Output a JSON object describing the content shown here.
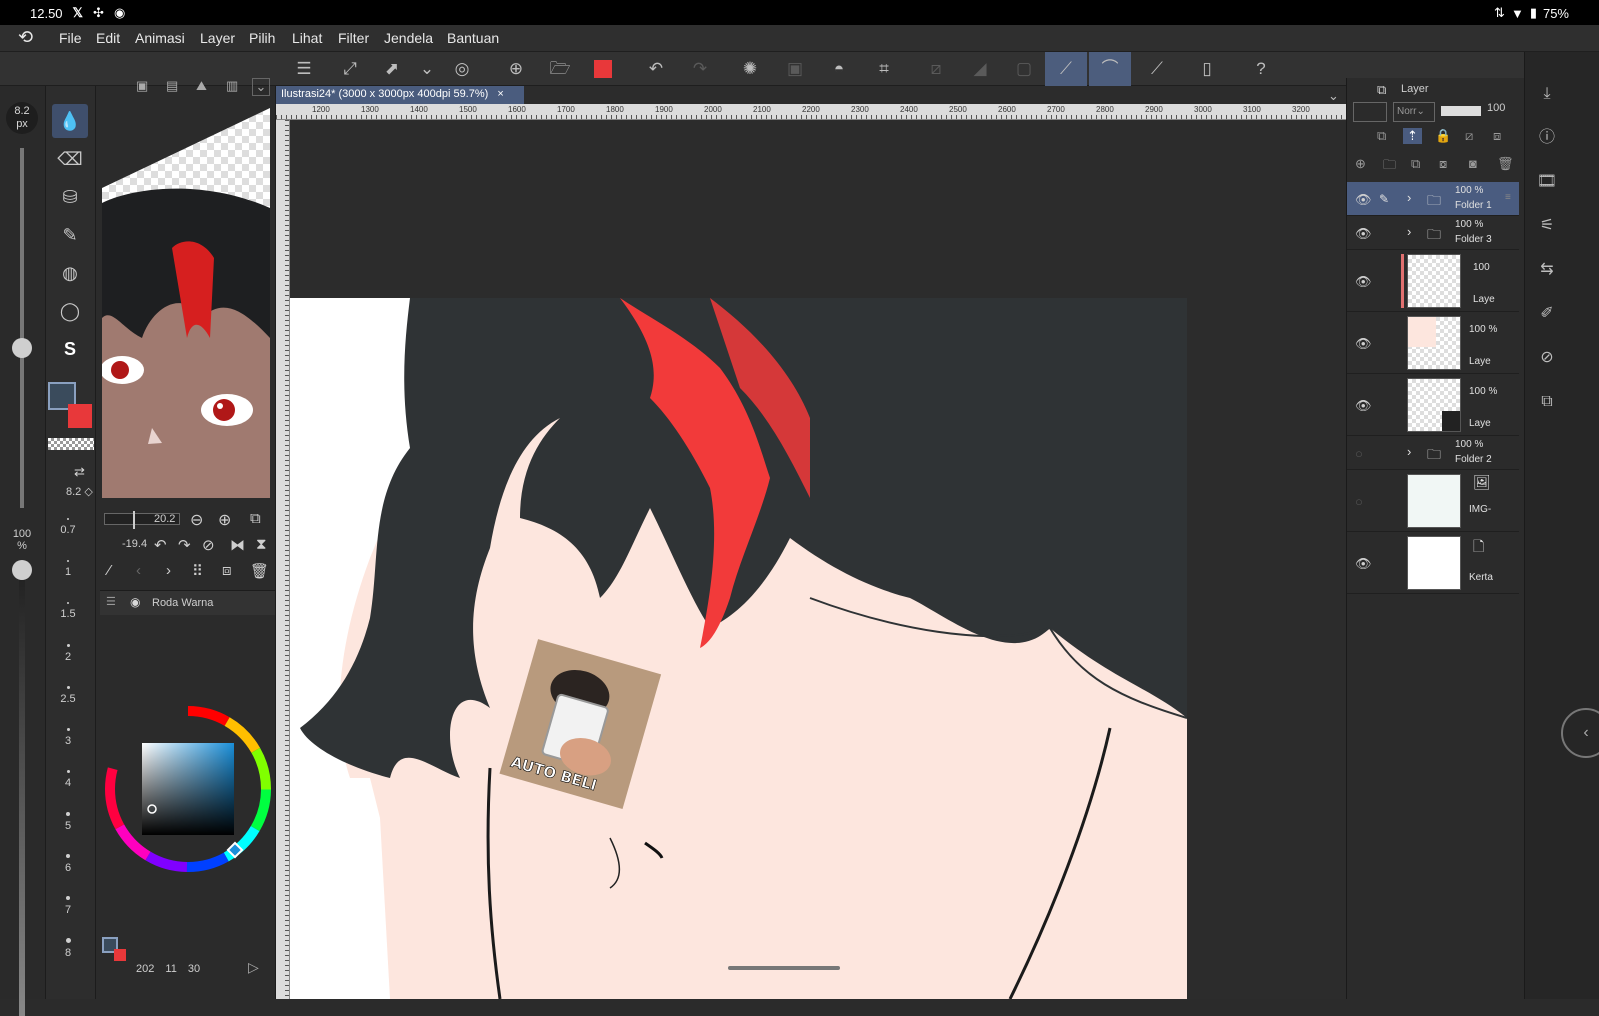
{
  "status": {
    "time": "12.50",
    "battery": "75%"
  },
  "menu": [
    "File",
    "Edit",
    "Animasi",
    "Layer",
    "Pilih",
    "Lihat",
    "Filter",
    "Jendela",
    "Bantuan"
  ],
  "brush": {
    "size_label": "8.2",
    "size_unit": "px",
    "size_value": "8.2",
    "opacity_label": "100",
    "opacity_unit": "%"
  },
  "brush_sizes": [
    "0.7",
    "1",
    "1.5",
    "2",
    "2.5",
    "3",
    "4",
    "5",
    "6",
    "7",
    "8"
  ],
  "navigator": {
    "zoom": "20.2",
    "rotation": "-19.4"
  },
  "color_panel": {
    "title": "Roda Warna"
  },
  "bottom_status": {
    "a": "202",
    "b": "11",
    "c": "30"
  },
  "document": {
    "tab_title": "Ilustrasi24* (3000 x 3000px 400dpi 59.7%)"
  },
  "ruler_marks": [
    "1200",
    "1300",
    "1400",
    "1500",
    "1600",
    "1700",
    "1800",
    "1900",
    "2000",
    "2100",
    "2200",
    "2300",
    "2400",
    "2500",
    "2600",
    "2700",
    "2800",
    "2900",
    "3000",
    "3100",
    "3200"
  ],
  "sticker": {
    "text": "AUTO BELI"
  },
  "layer_panel": {
    "title": "Layer",
    "blend": "Norr",
    "opacity": "100",
    "layers": [
      {
        "name": "Folder 1",
        "opacity": "100 %",
        "type": "folder",
        "selected": true
      },
      {
        "name": "Folder 3",
        "opacity": "100 %",
        "type": "folder",
        "selected": false
      },
      {
        "name": "Laye",
        "opacity": "100",
        "type": "raster",
        "selected": false
      },
      {
        "name": "Laye",
        "opacity": "100 %",
        "type": "raster",
        "selected": false
      },
      {
        "name": "Laye",
        "opacity": "100 %",
        "type": "raster",
        "selected": false
      },
      {
        "name": "Folder 2",
        "opacity": "100 %",
        "type": "folder",
        "selected": false
      },
      {
        "name": "IMG-",
        "opacity": "",
        "type": "image",
        "selected": false
      },
      {
        "name": "Kerta",
        "opacity": "",
        "type": "paper",
        "selected": false
      }
    ]
  },
  "colors": {
    "main": "#3a4b5c",
    "sub": "#e8383a",
    "accent": "#4c5d7d",
    "hair": "#2f3335",
    "hair_red": "#f23a3a",
    "skin": "#fde6de"
  }
}
